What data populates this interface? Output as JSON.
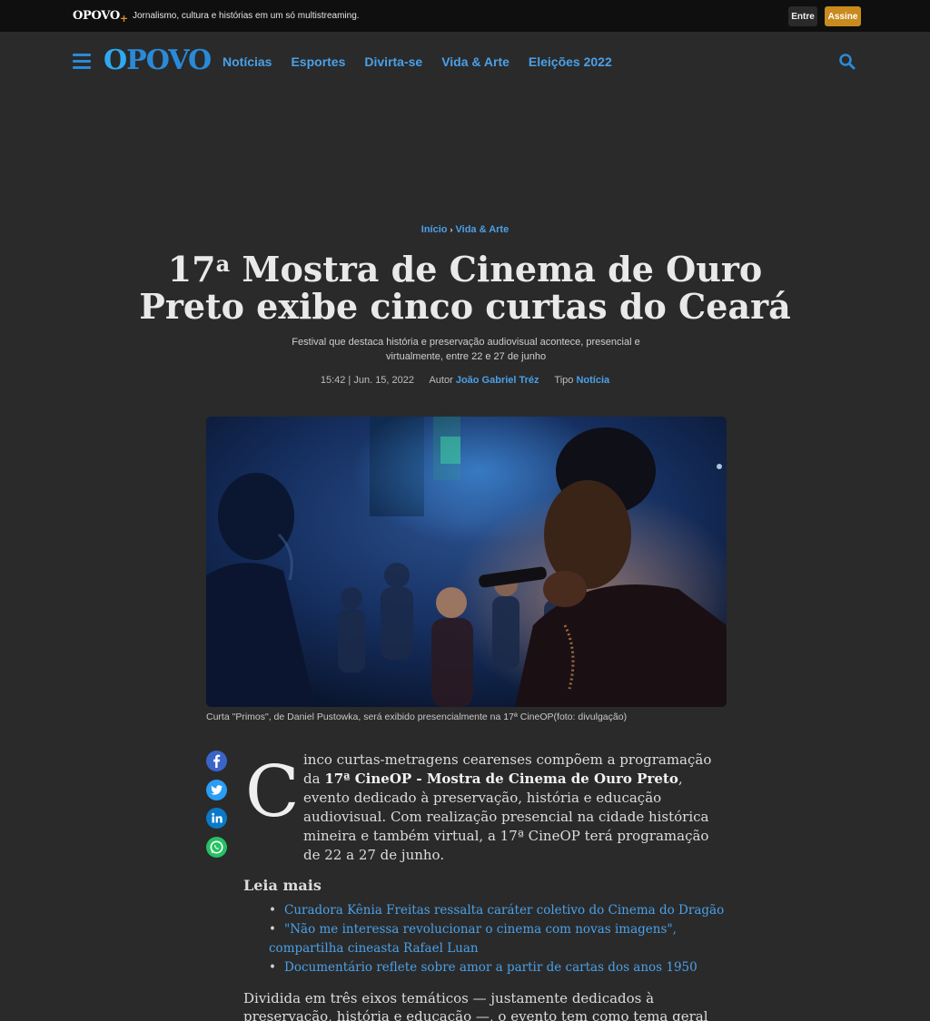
{
  "topbar": {
    "brand": "OPOVO",
    "brand_plus": "+",
    "tagline": "Jornalismo, cultura e histórias em um só multistreaming.",
    "login_label": "Entre",
    "subscribe_label": "Assine"
  },
  "nav": {
    "logo_o": "O",
    "logo_rest": "POVO",
    "items": [
      {
        "label": "Notícias"
      },
      {
        "label": "Esportes"
      },
      {
        "label": "Divirta-se"
      },
      {
        "label": "Vida & Arte"
      },
      {
        "label": "Eleições 2022"
      }
    ]
  },
  "breadcrumb": {
    "home": "Início",
    "separator": "›",
    "section": "Vida & Arte"
  },
  "article": {
    "title_num": "17",
    "title_sup": "a",
    "title_rest": " Mostra de Cinema de Ouro Preto exibe cinco curtas do Ceará",
    "subtitle": "Festival que destaca história e preservação audiovisual acontece, presencial e virtualmente, entre 22 e 27 de junho",
    "datetime": "15:42 | Jun. 15, 2022",
    "author_label": "Autor",
    "author": "João Gabriel Tréz",
    "type_label": "Tipo",
    "type": "Notícia",
    "caption": "Curta \"Primos\", de Daniel Pustowka, será exibido presencialmente na 17ª CineOP(foto: divulgação)",
    "dropcap": "C",
    "lead_before": "inco curtas-metragens cearenses compõem a programação da ",
    "lead_bold": "17ª CineOP - Mostra de Cinema de Ouro Preto",
    "lead_after": ", evento dedicado à preservação, história e educação audiovisual. Com realização presencial na cidade histórica mineira e também virtual, a 17ª CineOP terá programação de 22 a 27 de junho.",
    "read_more_title": "Leia mais",
    "read_more": [
      {
        "label": "Curadora Kênia Freitas ressalta caráter coletivo do Cinema do Dragão"
      },
      {
        "label": "\"Não me interessa revolucionar o cinema com novas imagens\", compartilha cineasta Rafael Luan"
      },
      {
        "label": "Documentário reflete sobre amor a partir de cartas dos anos 1950"
      }
    ],
    "paragraph2": "Dividida em três eixos temáticos — justamente dedicados à preservação, história e educação —, o evento tem como tema geral desta edição"
  },
  "colors": {
    "accent": "#4aa0e8",
    "subscribe": "#c98a1e",
    "background": "#2a2a2a",
    "facebook": "#3b64c8",
    "twitter": "#2a9df4",
    "linkedin": "#0a7ac8",
    "whatsapp": "#25c163"
  },
  "icons": {
    "menu": "hamburger-icon",
    "search": "search-icon",
    "share": [
      "facebook-icon",
      "twitter-icon",
      "linkedin-icon",
      "whatsapp-icon"
    ]
  }
}
